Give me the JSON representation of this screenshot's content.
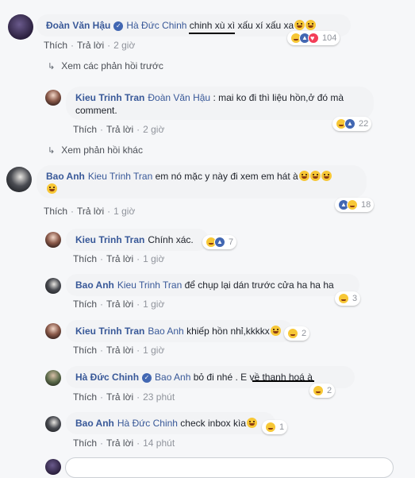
{
  "comments": [
    {
      "name": "Đoàn Văn Hậu",
      "verified": true,
      "tag": "Hà Đức Chinh",
      "text": "chinh xù xì xấu xí xấu xa",
      "like": "Thích",
      "reply": "Trả lời",
      "time": "2 giờ",
      "reactions": "104"
    },
    {
      "more": "Xem các phản hồi trước"
    },
    {
      "name": "Kieu Trinh Tran",
      "tag": "Đoàn Văn Hậu",
      "text": ": mai ko đi thì liệu hồn,ở đó mà",
      "text2": "comment.",
      "like": "Thích",
      "reply": "Trả lời",
      "time": "2 giờ",
      "reactions": "22"
    },
    {
      "more": "Xem phản hồi khác"
    },
    {
      "name": "Bao Anh",
      "tag": "Kieu Trinh Tran",
      "text": "em nó mặc y này đi xem em hát à",
      "like": "Thích",
      "reply": "Trả lời",
      "time": "1 giờ",
      "reactions": "18"
    },
    {
      "name": "Kieu Trinh Tran",
      "text": "Chính xác.",
      "like": "Thích",
      "reply": "Trả lời",
      "time": "1 giờ",
      "reactions": "7"
    },
    {
      "name": "Bao Anh",
      "tag": "Kieu Trinh Tran",
      "text": "để chụp lại dán trước cửa ha ha ha",
      "like": "Thích",
      "reply": "Trả lời",
      "time": "1 giờ",
      "reactions": "3"
    },
    {
      "name": "Kieu Trinh Tran",
      "tag": "Bao Anh",
      "text": "khiếp hồn nhỉ,kkkkx",
      "like": "Thích",
      "reply": "Trả lời",
      "time": "1 giờ",
      "reactions": "2"
    },
    {
      "name": "Hà Đức Chinh",
      "verified": true,
      "tag": "Bao Anh",
      "text": "bỏ đi nhé . E về thanh hoá à",
      "like": "Thích",
      "reply": "Trả lời",
      "time": "23 phút",
      "reactions": "2"
    },
    {
      "name": "Bao Anh",
      "tag": "Hà Đức Chinh",
      "text": "check inbox kìa",
      "like": "Thích",
      "reply": "Trả lời",
      "time": "14 phút",
      "reactions": "1"
    }
  ],
  "colors": {
    "link": "#385898",
    "meta": "#90949c",
    "bubble": "#f2f3f5",
    "background": "#f6f7f9"
  }
}
